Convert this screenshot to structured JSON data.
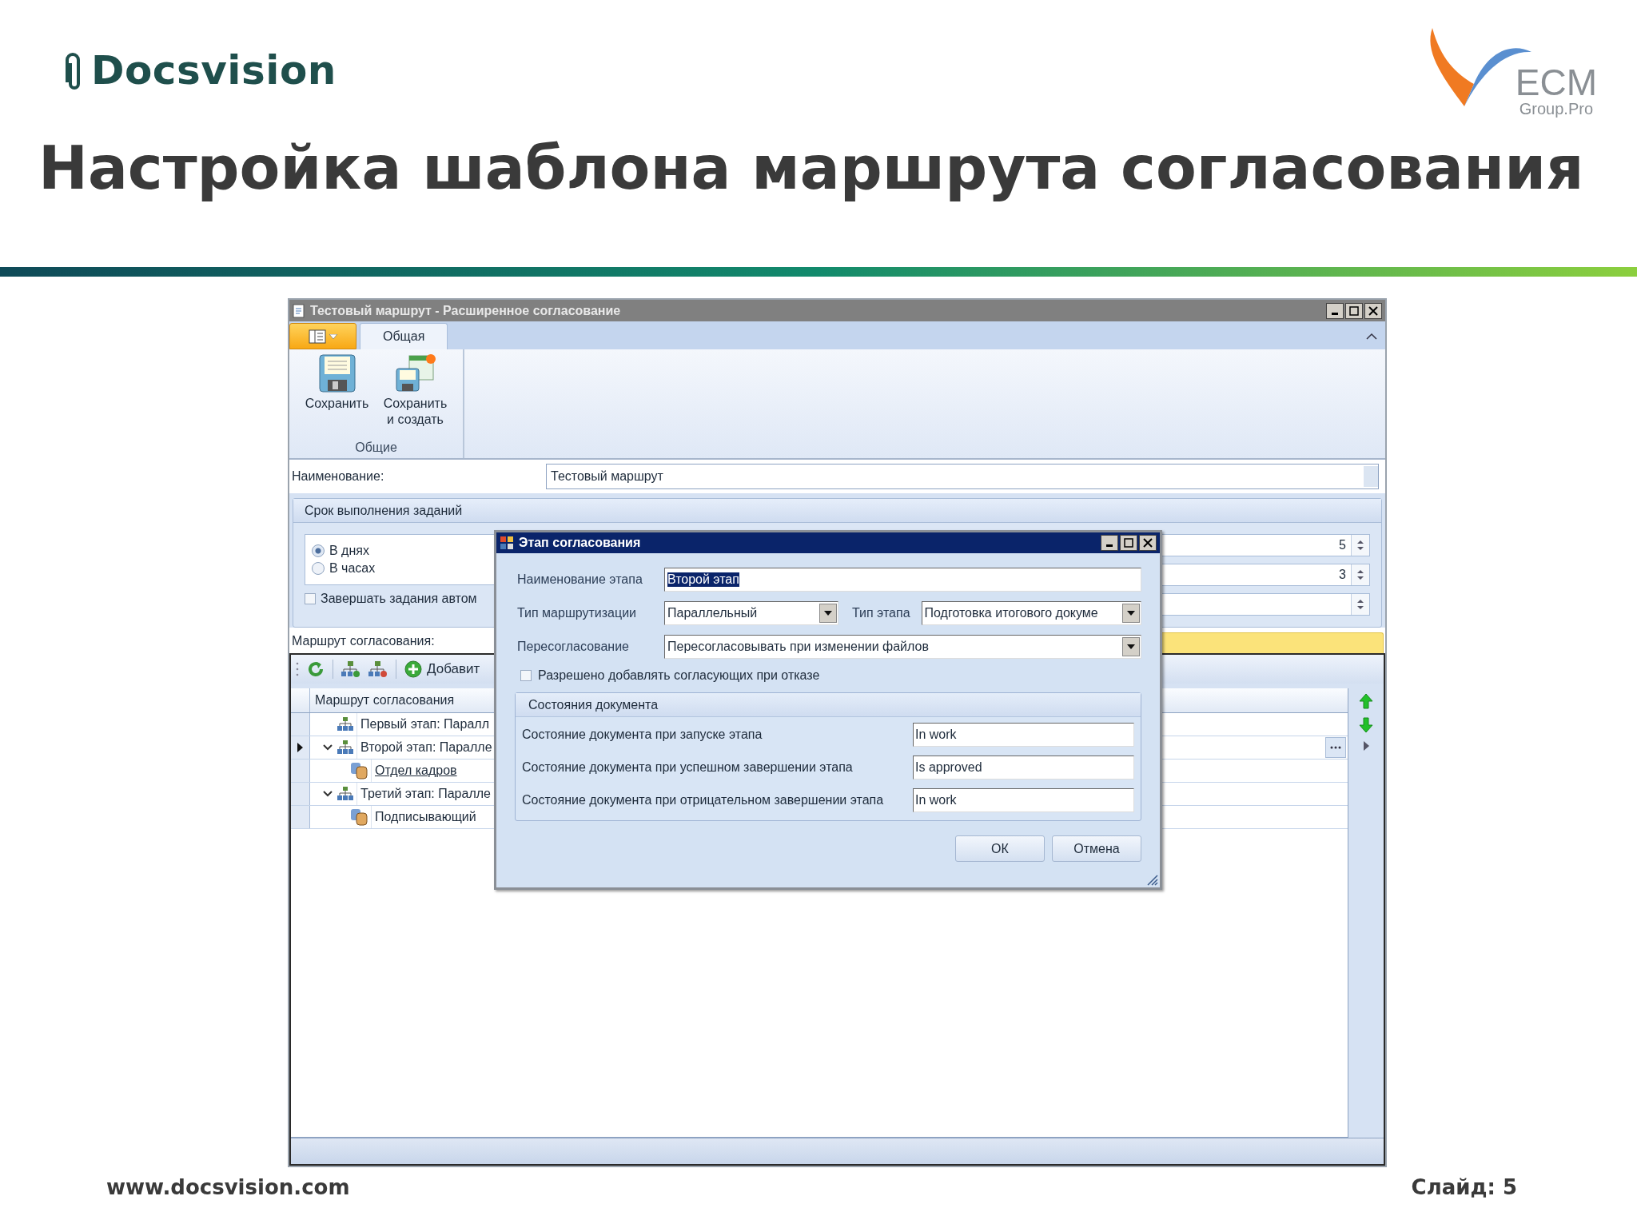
{
  "slide": {
    "brand": "Docsvision",
    "partner_mark": "ECM",
    "partner_sub": "Group.Pro",
    "title": "Настройка шаблона маршрута согласования",
    "footer_url": "www.docsvision.com",
    "slide_number": "Слайд: 5"
  },
  "window": {
    "title": "Тестовый маршрут - Расширенное согласование",
    "ribbon": {
      "tabs": [
        {
          "label": "Общая",
          "selected": true
        }
      ],
      "buttons": [
        {
          "kind": "save",
          "label": "Сохранить"
        },
        {
          "kind": "save_new",
          "label": "Сохранить и создать"
        }
      ],
      "group": "Общие"
    },
    "name": {
      "label": "Наименование:",
      "value": "Тестовый маршрут"
    },
    "deadline": {
      "title": "Срок выполнения заданий",
      "units": [
        {
          "label": "В днях",
          "selected": true
        },
        {
          "label": "В часах",
          "selected": false
        }
      ],
      "auto_complete": {
        "label": "Завершать задания автом",
        "checked": false
      },
      "spins": [
        {
          "kind": "number",
          "value": "5"
        },
        {
          "kind": "number",
          "value": "3"
        },
        {
          "kind": "blank"
        }
      ]
    },
    "route": {
      "label": "Маршрут согласования:",
      "add_label": "Добавит",
      "column": "Маршрут согласования",
      "rows": [
        {
          "label": "Первый этап: Паралл",
          "current": false
        },
        {
          "label": "Второй этап: Паралле",
          "current": true,
          "children": [
            {
              "label": "Отдел кадров",
              "current": false,
              "link": true
            }
          ]
        },
        {
          "label": "Третий этап: Паралле",
          "current": false,
          "children": [
            {
              "label": "Подписывающий",
              "current": false,
              "link": false
            }
          ]
        }
      ]
    }
  },
  "dialog": {
    "title": "Этап согласования",
    "stage_name": {
      "label": "Наименование этапа",
      "value": "Второй этап",
      "highlighted": true
    },
    "routing_type": {
      "label": "Тип маршрутизации",
      "value": "Параллельный"
    },
    "stage_type": {
      "label": "Тип этапа",
      "value": "Подготовка итогового докуме"
    },
    "reapproval": {
      "label": "Пересогласование",
      "value": "Пересогласовывать при изменении файлов"
    },
    "allow_add": {
      "label": "Разрешено добавлять согласующих при отказе",
      "checked": false
    },
    "states": {
      "title": "Состояния документа",
      "rows": [
        {
          "label": "Состояние документа при запуске этапа",
          "value": "In work"
        },
        {
          "label": "Состояние документа при успешном завершении этапа",
          "value": "Is approved"
        },
        {
          "label": "Состояние документа при отрицательном завершении этапа",
          "value": "In work"
        }
      ]
    },
    "buttons": [
      "ОК",
      "Отмена"
    ]
  }
}
